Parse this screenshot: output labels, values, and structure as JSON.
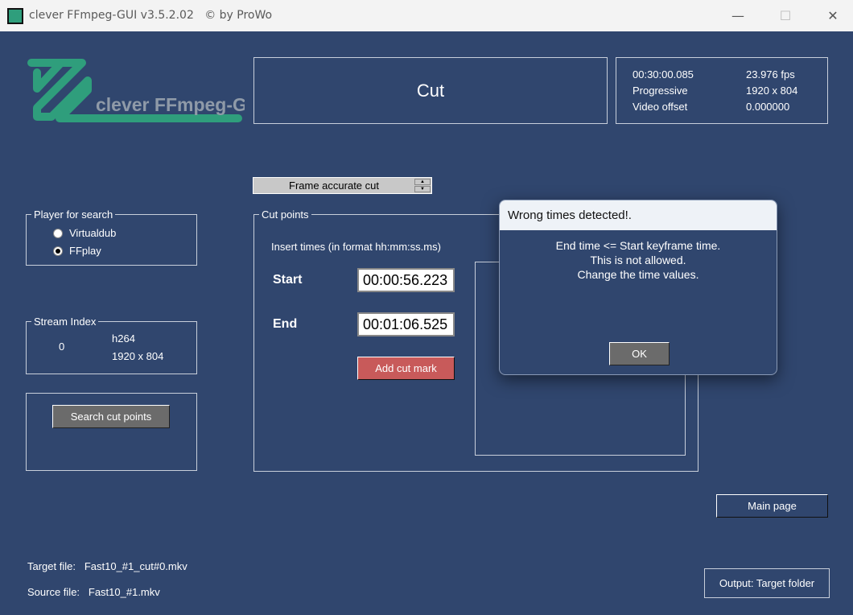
{
  "window": {
    "title": "clever FFmpeg-GUI v3.5.2.02",
    "copyright": "© by ProWo",
    "minimize": "—",
    "maximize": "☐",
    "close": "✕"
  },
  "logo": {
    "text": "clever FFmpeg-GUI"
  },
  "page": {
    "title": "Cut"
  },
  "info": {
    "duration": "00:30:00.085",
    "fps": "23.976 fps",
    "scan": "Progressive",
    "resolution": "1920 x 804",
    "offset_label": "Video offset",
    "offset": "0.000000"
  },
  "mode": {
    "selected": "Frame accurate cut"
  },
  "player": {
    "legend": "Player for search",
    "options": [
      {
        "label": "Virtualdub",
        "checked": false
      },
      {
        "label": "FFplay",
        "checked": true
      }
    ]
  },
  "stream": {
    "legend": "Stream Index",
    "index": "0",
    "codec": "h264",
    "resolution": "1920 x 804"
  },
  "search_button": "Search cut points",
  "cut": {
    "legend": "Cut points",
    "hint": "Insert times (in format hh:mm:ss.ms)",
    "start_label": "Start",
    "start": "00:00:56.223",
    "end_label": "End",
    "end": "00:01:06.525",
    "add_button": "Add cut mark"
  },
  "main_page_button": "Main page",
  "files": {
    "target_label": "Target file:",
    "target": "Fast10_#1_cut#0.mkv",
    "source_label": "Source file:",
    "source": "Fast10_#1.mkv"
  },
  "output_button": "Output: Target folder",
  "dialog": {
    "title": "Wrong times detected!.",
    "lines": [
      "End time <= Start keyframe time.",
      "This is not allowed.",
      "Change the time values."
    ],
    "ok": "OK"
  },
  "colors": {
    "bg": "#30466e",
    "accent": "#2f9e7c",
    "add_button": "#c85a5a"
  }
}
